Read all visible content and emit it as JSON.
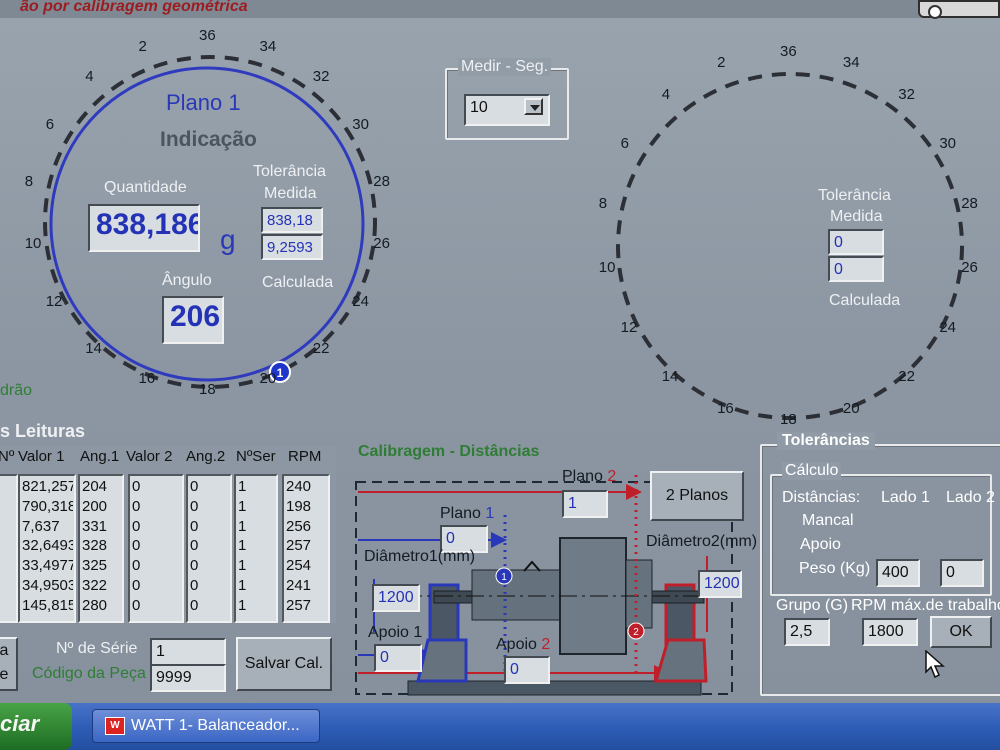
{
  "window": {
    "title_fragment": "ão por calibragem geométrica"
  },
  "plane1": {
    "title": "Plano 1",
    "subtitle": "Indicação",
    "quantity_label": "Quantidade",
    "quantity_value": "838,186",
    "unit": "g",
    "angle_label": "Ângulo",
    "angle_value": "206",
    "tolerance_label": "Tolerância",
    "measured_label": "Medida",
    "tolerance_measured": "838,18",
    "tolerance_calculated": "9,2593",
    "calculated_label": "Calculada",
    "marker": "1",
    "standard_text": "drão"
  },
  "plane2": {
    "tolerance_label": "Tolerância",
    "measured_label": "Medida",
    "tolerance_measured": "0",
    "tolerance_calculated": "0",
    "calculated_label": "Calculada"
  },
  "dial": {
    "ticks": [
      "36",
      "34",
      "32",
      "30",
      "28",
      "26",
      "24",
      "22",
      "20",
      "18",
      "16",
      "14",
      "12",
      "10",
      "8",
      "6",
      "4",
      "2"
    ]
  },
  "measure_seg": {
    "label": "Medir - Seg.",
    "value": "10"
  },
  "readings": {
    "title": "s Leituras",
    "headers": [
      "Nº",
      "Valor 1",
      "Ang.1",
      "Valor 2",
      "Ang.2",
      "NºSer",
      "RPM"
    ],
    "rows": [
      [
        "821,257",
        "204",
        "0",
        "0",
        "1",
        "240"
      ],
      [
        "790,318",
        "200",
        "0",
        "0",
        "1",
        "198"
      ],
      [
        "7,637",
        "331",
        "0",
        "0",
        "1",
        "256"
      ],
      [
        "32,6493",
        "328",
        "0",
        "0",
        "1",
        "257"
      ],
      [
        "33,4977",
        "325",
        "0",
        "0",
        "1",
        "254"
      ],
      [
        "34,9503",
        "322",
        "0",
        "0",
        "1",
        "241"
      ],
      [
        "145,815",
        "280",
        "0",
        "0",
        "1",
        "257"
      ]
    ]
  },
  "serial": {
    "label": "Nº de Série",
    "value": "1",
    "piece_label": "Código da Peça",
    "piece_value": "9999",
    "save_button": "Salvar Cal.",
    "left_button_top": "a",
    "left_button_bottom": "e"
  },
  "calibration": {
    "title": "Calibragem - Distâncias",
    "plano2_label": "Plano",
    "plano2_num": "2",
    "plano2_value": "1",
    "two_planes_button": "2 Planos",
    "plano1_label": "Plano",
    "plano1_num": "1",
    "plano1_value": "0",
    "diameter1_label": "Diâmetro1(mm)",
    "diameter1_value": "1200",
    "diameter2_label": "Diâmetro2(mm)",
    "diameter2_value": "1200",
    "apoio1_label": "Apoio 1",
    "apoio1_value": "0",
    "apoio2_label": "Apoio",
    "apoio2_num": "2",
    "apoio2_value": "0"
  },
  "tolerances": {
    "title": "Tolerâncias",
    "calc_label": "Cálculo",
    "distances_label": "Distâncias:",
    "side1_label": "Lado 1",
    "side2_label": "Lado 2",
    "bearing_label": "Mancal",
    "support_label": "Apoio",
    "weight_label": "Peso (Kg)",
    "weight_value": "400",
    "side2_value": "0",
    "group_label": "Grupo (G)",
    "rpm_label": "RPM máx.de trabalho",
    "group_value": "2,5",
    "rpm_value": "1800",
    "ok_button": "OK"
  },
  "taskbar": {
    "start_label": "ciar",
    "task_label": "WATT 1- Balanceador..."
  },
  "colors": {
    "plane1_blue": "#2938b8",
    "plane2_red": "#c01f2a",
    "green": "#2f7d35"
  }
}
